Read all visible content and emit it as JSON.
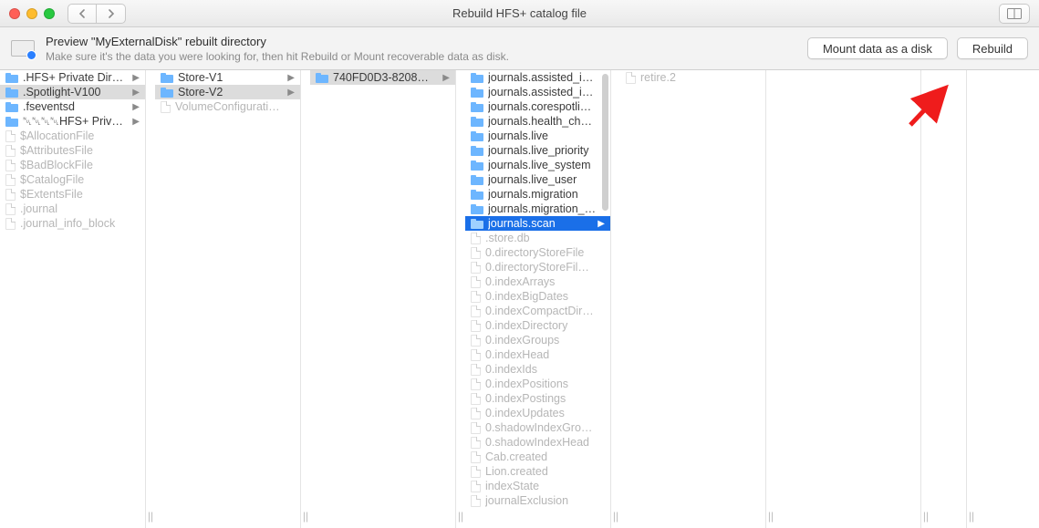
{
  "window": {
    "title": "Rebuild HFS+ catalog file"
  },
  "header": {
    "title": "Preview \"MyExternalDisk\" rebuilt directory",
    "subtitle": "Make sure it's the data you were looking for, then hit Rebuild or Mount recoverable data as disk.",
    "mount_label": "Mount data as a disk",
    "rebuild_label": "Rebuild"
  },
  "columns": [
    {
      "id": "c0",
      "items": [
        {
          "label": ".HFS+ Private Dire…",
          "type": "folder",
          "arrow": true
        },
        {
          "label": ".Spotlight-V100",
          "type": "folder",
          "arrow": true,
          "selected": true
        },
        {
          "label": ".fseventsd",
          "type": "folder",
          "arrow": true
        },
        {
          "label": "␀␀␀␀HFS+ Private D…",
          "type": "folder",
          "arrow": true
        },
        {
          "label": "$AllocationFile",
          "type": "file",
          "dim": true
        },
        {
          "label": "$AttributesFile",
          "type": "file",
          "dim": true
        },
        {
          "label": "$BadBlockFile",
          "type": "file",
          "dim": true
        },
        {
          "label": "$CatalogFile",
          "type": "file",
          "dim": true
        },
        {
          "label": "$ExtentsFile",
          "type": "file",
          "dim": true
        },
        {
          "label": ".journal",
          "type": "file",
          "dim": true
        },
        {
          "label": ".journal_info_block",
          "type": "file",
          "dim": true
        }
      ]
    },
    {
      "id": "c1",
      "items": [
        {
          "label": "Store-V1",
          "type": "folder",
          "arrow": true
        },
        {
          "label": "Store-V2",
          "type": "folder",
          "arrow": true,
          "selected": true
        },
        {
          "label": "VolumeConfigurati…",
          "type": "file",
          "dim": true
        }
      ]
    },
    {
      "id": "c2",
      "items": [
        {
          "label": "740FD0D3-8208…",
          "type": "folder",
          "arrow": true,
          "selected": true
        }
      ]
    },
    {
      "id": "c3",
      "scrollbar": true,
      "items": [
        {
          "label": "journals.assisted_i…",
          "type": "folder"
        },
        {
          "label": "journals.assisted_i…",
          "type": "folder"
        },
        {
          "label": "journals.corespotli…",
          "type": "folder"
        },
        {
          "label": "journals.health_ch…",
          "type": "folder"
        },
        {
          "label": "journals.live",
          "type": "folder"
        },
        {
          "label": "journals.live_priority",
          "type": "folder"
        },
        {
          "label": "journals.live_system",
          "type": "folder"
        },
        {
          "label": "journals.live_user",
          "type": "folder"
        },
        {
          "label": "journals.migration",
          "type": "folder"
        },
        {
          "label": "journals.migration_…",
          "type": "folder"
        },
        {
          "label": "journals.scan",
          "type": "folder",
          "arrow": true,
          "selected_blue": true
        },
        {
          "label": ".store.db",
          "type": "file",
          "dim": true
        },
        {
          "label": "0.directoryStoreFile",
          "type": "file",
          "dim": true
        },
        {
          "label": "0.directoryStoreFil…",
          "type": "file",
          "dim": true
        },
        {
          "label": "0.indexArrays",
          "type": "file",
          "dim": true
        },
        {
          "label": "0.indexBigDates",
          "type": "file",
          "dim": true
        },
        {
          "label": "0.indexCompactDir…",
          "type": "file",
          "dim": true
        },
        {
          "label": "0.indexDirectory",
          "type": "file",
          "dim": true
        },
        {
          "label": "0.indexGroups",
          "type": "file",
          "dim": true
        },
        {
          "label": "0.indexHead",
          "type": "file",
          "dim": true
        },
        {
          "label": "0.indexIds",
          "type": "file",
          "dim": true
        },
        {
          "label": "0.indexPositions",
          "type": "file",
          "dim": true
        },
        {
          "label": "0.indexPostings",
          "type": "file",
          "dim": true
        },
        {
          "label": "0.indexUpdates",
          "type": "file",
          "dim": true
        },
        {
          "label": "0.shadowIndexGro…",
          "type": "file",
          "dim": true
        },
        {
          "label": "0.shadowIndexHead",
          "type": "file",
          "dim": true
        },
        {
          "label": "Cab.created",
          "type": "file",
          "dim": true
        },
        {
          "label": "Lion.created",
          "type": "file",
          "dim": true
        },
        {
          "label": "indexState",
          "type": "file",
          "dim": true
        },
        {
          "label": "journalExclusion",
          "type": "file",
          "dim": true
        }
      ]
    },
    {
      "id": "c4",
      "items": [
        {
          "label": "retire.2",
          "type": "file",
          "dim": true
        }
      ]
    },
    {
      "id": "c5",
      "items": []
    },
    {
      "id": "c6",
      "narrow": true,
      "items": []
    }
  ]
}
